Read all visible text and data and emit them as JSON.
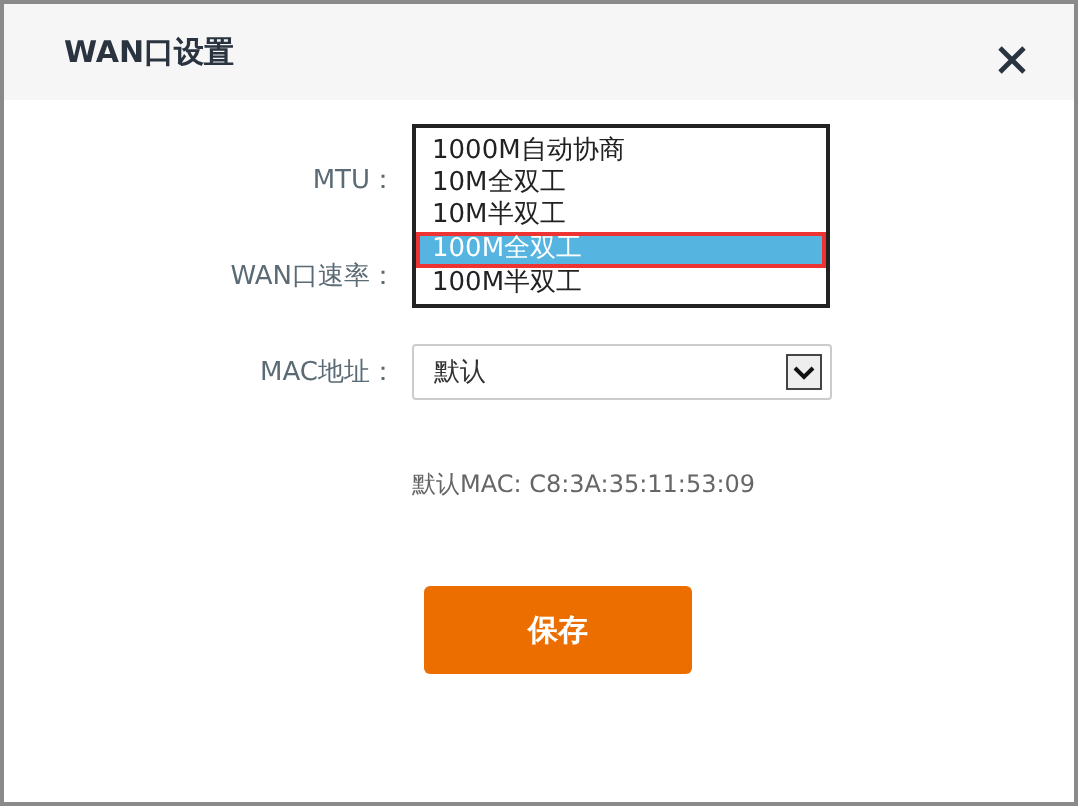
{
  "dialog": {
    "title": "WAN口设置"
  },
  "form": {
    "fields": [
      {
        "label": "MTU："
      },
      {
        "label": "WAN口速率："
      },
      {
        "label": "MAC地址：",
        "value": "默认"
      }
    ],
    "speed_options": [
      {
        "label": "1000M自动协商",
        "selected": false
      },
      {
        "label": "10M全双工",
        "selected": false
      },
      {
        "label": "10M半双工",
        "selected": false
      },
      {
        "label": "100M全双工",
        "selected": true
      },
      {
        "label": "100M半双工",
        "selected": false
      }
    ],
    "hint": "默认MAC: C8:3A:35:11:53:09"
  },
  "buttons": [
    {
      "label": "保存"
    }
  ]
}
